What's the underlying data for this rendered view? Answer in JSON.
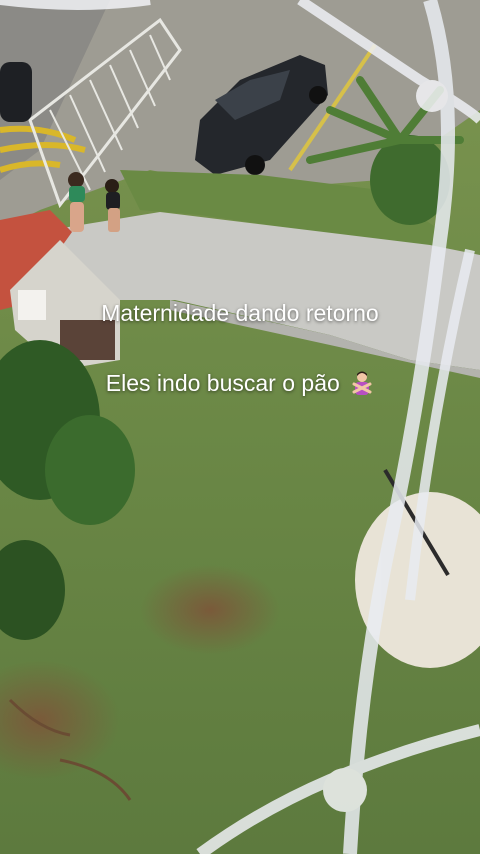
{
  "captions": {
    "line1": "Maternidade dando retorno",
    "line2": "Eles indo buscar o pão"
  },
  "icons": {
    "caption_emoji": "person-gesturing-no-emoji"
  },
  "colors": {
    "grass": "#6f8a4a",
    "pavement": "#c9c9c5",
    "roof": "#c4523f",
    "net": "#e9ecf2",
    "caption": "#ffffff"
  }
}
